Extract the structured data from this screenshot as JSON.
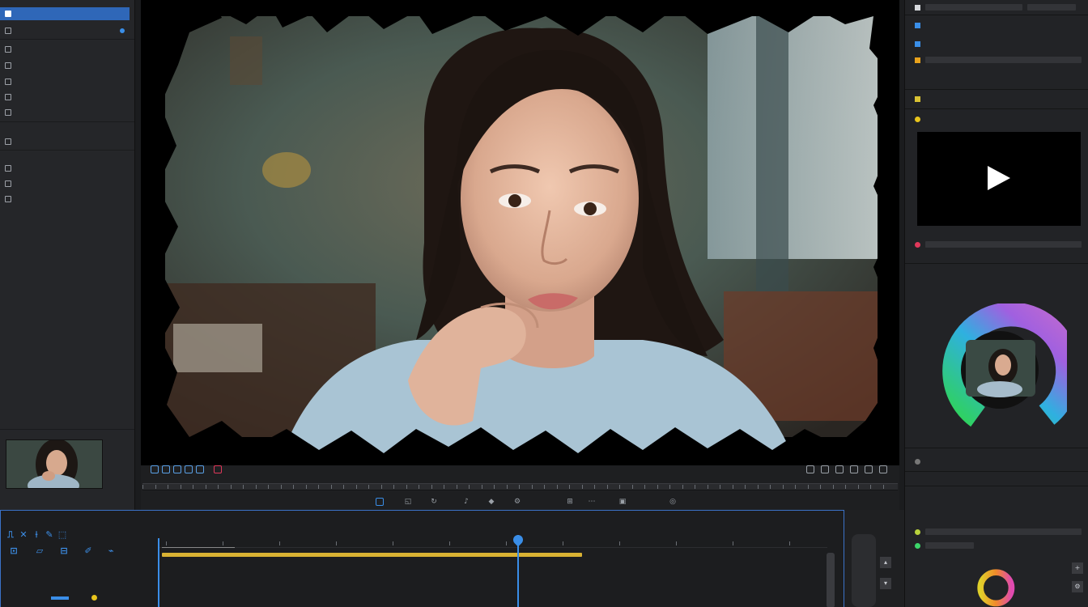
{
  "colors": {
    "accent": "#2f67b8",
    "playhead": "#3a8ee8",
    "clip": "#d9b233",
    "panel": "#252629",
    "record": "#e0385a",
    "green_dot": "#3cd66a",
    "yellow_sq": "#e8a21c"
  },
  "left_panel": {
    "rows": [
      {
        "icon": "folder-icon"
      },
      {
        "icon": "folder-icon"
      },
      {
        "icon": "media-icon"
      },
      {
        "icon": "media-icon"
      },
      {
        "icon": "media-icon"
      },
      {
        "icon": "media-icon"
      },
      {
        "icon": "media-icon"
      },
      {
        "icon": "media-icon"
      },
      {
        "icon": "media-icon"
      },
      {
        "icon": "media-icon"
      }
    ]
  },
  "viewer": {
    "toolbar_icons": [
      "zoom-icon",
      "crop-icon",
      "loop-icon",
      "audio-icon",
      "marker-icon",
      "settings-icon",
      "fit-icon",
      "more-icon"
    ]
  },
  "right_panel": {
    "preview_icon": "play-icon"
  },
  "timeline": {
    "tool_icons": [
      "select-icon",
      "trim-icon",
      "razor-icon",
      "pen-icon",
      "hand-icon",
      "zoom-icon",
      "blade-icon",
      "slip-icon",
      "slide-icon",
      "ripple-icon"
    ],
    "playhead_fraction": 0.538
  }
}
